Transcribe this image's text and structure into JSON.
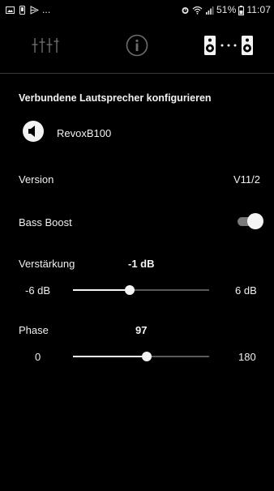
{
  "status_bar": {
    "left_text": "...",
    "battery": "51%",
    "time": "11:07",
    "icons": [
      "image-icon",
      "phone-icon",
      "cast-icon",
      "alarm-icon",
      "wifi-icon",
      "signal-icon",
      "battery-icon"
    ]
  },
  "toolbar": {
    "tabs": [
      {
        "name": "equalizer-icon"
      },
      {
        "name": "info-icon"
      },
      {
        "name": "speaker-pair-icon"
      }
    ]
  },
  "section": {
    "title": "Verbundene Lautsprecher konfigurieren"
  },
  "speaker": {
    "name": "RevoxB100"
  },
  "version": {
    "label": "Version",
    "value": "V11/2"
  },
  "bass_boost": {
    "label": "Bass Boost",
    "enabled": true
  },
  "gain": {
    "label": "Verstärkung",
    "value": "-1 dB",
    "min": "-6 dB",
    "max": "6 dB",
    "fraction": 0.417
  },
  "phase": {
    "label": "Phase",
    "value": "97",
    "min": "0",
    "max": "180",
    "fraction": 0.539
  }
}
